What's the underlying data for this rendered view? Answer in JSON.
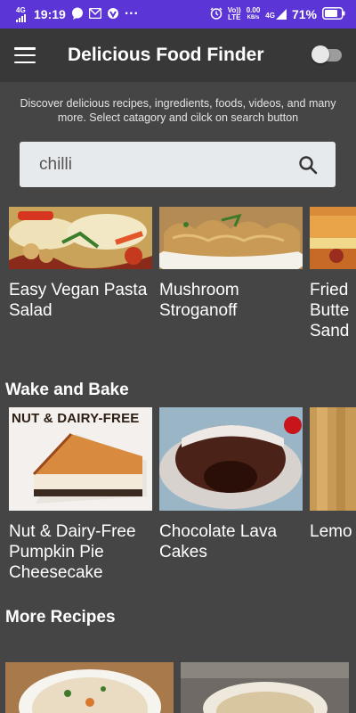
{
  "status_bar": {
    "time": "19:19",
    "signal_label": "4G",
    "dots": "···",
    "volte_top": "Vo))",
    "volte_bottom": "LTE",
    "speed_top": "0.00",
    "speed_bottom": "KB/s",
    "network_right": "4G",
    "battery": "71%"
  },
  "app_bar": {
    "title": "Delicious Food Finder"
  },
  "description": "Discover delicious recipes, ingredients, foods, videos, and many more. Select catagory and cilck on search button",
  "search": {
    "value": "chilli"
  },
  "top_row": [
    {
      "name": "Easy Vegan Pasta Salad"
    },
    {
      "name": "Mushroom Stroganoff"
    },
    {
      "name": "Fried Butte Sand"
    }
  ],
  "wake_and_bake": {
    "title": "Wake and Bake",
    "items": [
      {
        "name": "Nut & Dairy-Free Pumpkin Pie Cheesecake",
        "image_text": "NUT & DAIRY-FREE"
      },
      {
        "name": "Chocolate Lava Cakes"
      },
      {
        "name": "Lemo"
      }
    ]
  },
  "more_recipes": {
    "title": "More Recipes"
  },
  "colors": {
    "status_bar": "#5c35d6",
    "app_bar": "#383838",
    "background": "#454545",
    "search_bg": "#e7eaec"
  }
}
